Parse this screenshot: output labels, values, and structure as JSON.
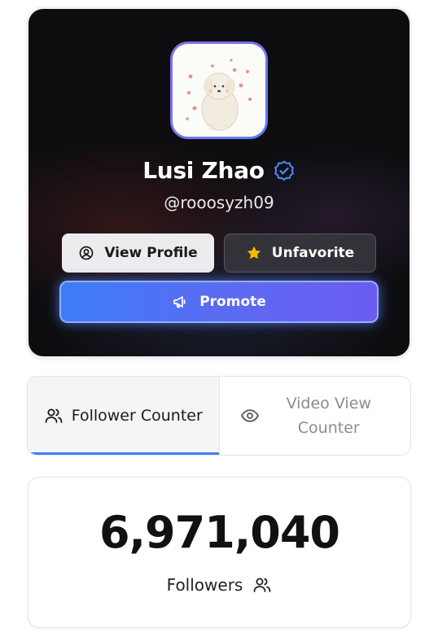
{
  "profile": {
    "name": "Lusi Zhao",
    "handle": "@rooosyzh09",
    "verified_icon": "verified-badge-icon",
    "avatar_icon": "avatar-illustration"
  },
  "actions": {
    "view_profile_label": "View Profile",
    "unfavorite_label": "Unfavorite",
    "promote_label": "Promote"
  },
  "tabs": [
    {
      "label": "Follower Counter",
      "icon": "users-icon",
      "active": true
    },
    {
      "label": "Video View Counter",
      "icon": "eye-icon",
      "active": false
    }
  ],
  "counter": {
    "value": "6,971,040",
    "label": "Followers",
    "icon": "users-icon"
  },
  "colors": {
    "accent": "#3b82f6",
    "promote_gradient_start": "#3d7cf5",
    "promote_gradient_end": "#6c5cf0",
    "star": "#f5b800"
  }
}
